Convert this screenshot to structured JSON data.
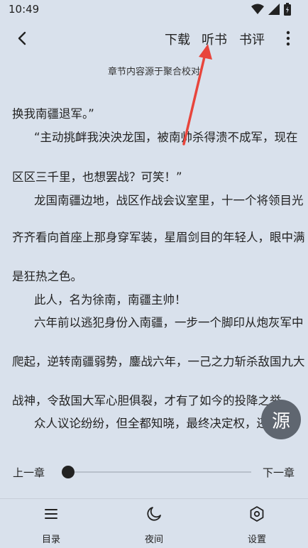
{
  "status_bar": {
    "time": "10:49"
  },
  "toolbar": {
    "download": "下载",
    "listen": "听书",
    "review": "书评"
  },
  "source_note": "章节内容源于聚合校对",
  "content": {
    "lines": [
      "换我南疆退军。”",
      "“主动挑衅我泱泱龙国，被南帅杀得溃不成军，现在",
      "区区三千里，也想罢战？可笑！”",
      "龙国南疆边地，战区作战会议室里，十一个将领目光",
      "齐齐看向首座上那身穿军装，星眉剑目的年轻人，眼中满",
      "是狂热之色。",
      "此人，名为徐南，南疆主帅！",
      "六年前以逃犯身份入南疆，一步一个脚印从炮灰军中",
      "爬起，逆转南疆弱势，鏖战六年，一己之力斩杀敌国九大",
      "战神，令敌国大军心胆俱裂，才有了如今的投降之举。",
      "众人议论纷纷，但全都知晓，最终决定权，还"
    ]
  },
  "fab": {
    "label": "源"
  },
  "chapter_nav": {
    "prev": "上一章",
    "next": "下一章",
    "progress": 0
  },
  "bottom_nav": {
    "toc": "目录",
    "night": "夜间",
    "settings": "设置"
  },
  "colors": {
    "background": "#d9e1ec",
    "annotation_arrow": "#e8453c",
    "fab": "#5f6670"
  }
}
